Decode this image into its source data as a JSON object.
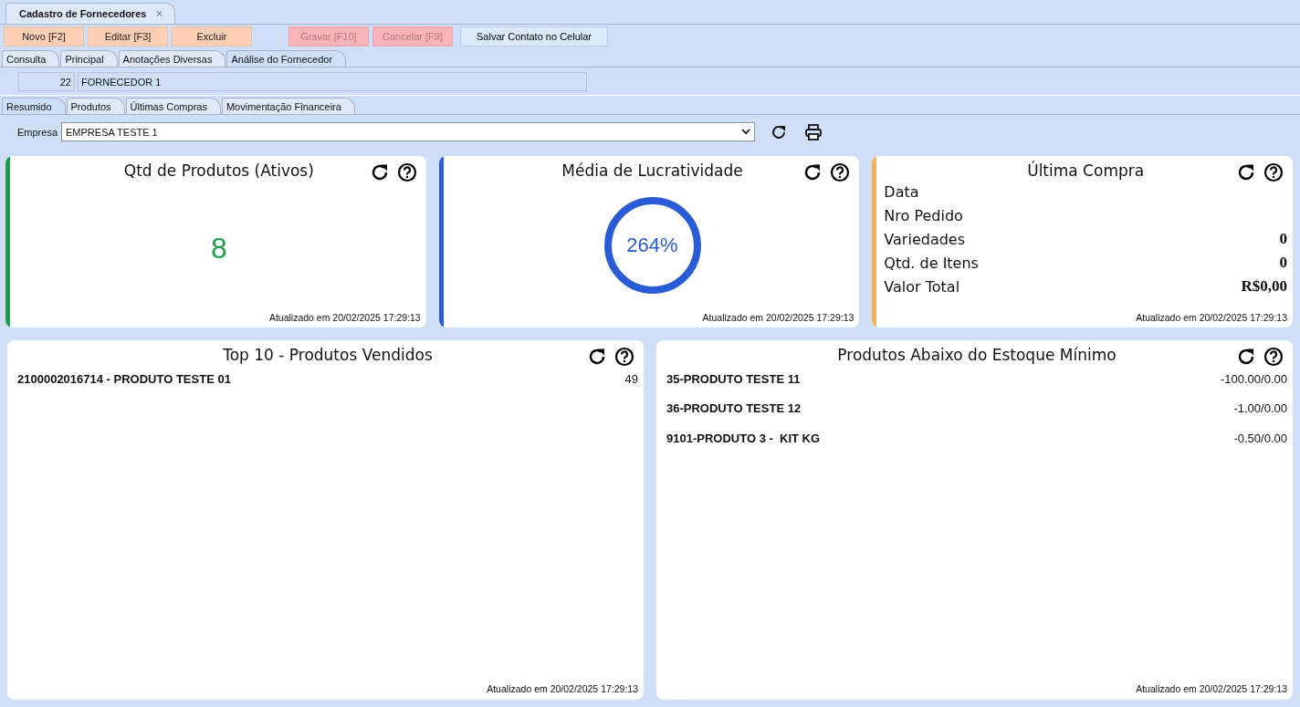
{
  "document_tab": {
    "title": "Cadastro de Fornecedores",
    "close": "×"
  },
  "toolbar": [
    [
      {
        "label": "Novo [F2]",
        "kind": "action",
        "disabled": false
      },
      {
        "label": "Editar [F3]",
        "kind": "action",
        "disabled": false
      },
      {
        "label": "Excluir",
        "kind": "action",
        "disabled": false
      }
    ],
    [
      {
        "label": "Gravar [F10]",
        "kind": "action",
        "disabled": true
      },
      {
        "label": "Cancelar [F9]",
        "kind": "action",
        "disabled": true
      }
    ],
    [
      {
        "label": "Salvar Contato no Celular",
        "kind": "info",
        "disabled": false
      }
    ]
  ],
  "main_tabs": [
    {
      "label": "Consulta",
      "selected": false
    },
    {
      "label": "Principal",
      "selected": false
    },
    {
      "label": "Anotações Diversas",
      "selected": false
    },
    {
      "label": "Análise do Fornecedor",
      "selected": true
    }
  ],
  "supplier": {
    "code": "22",
    "name": "FORNECEDOR 1"
  },
  "sub_tabs": [
    {
      "label": "Resumido",
      "selected": true
    },
    {
      "label": "Produtos",
      "selected": false
    },
    {
      "label": "Últimas Compras",
      "selected": false
    },
    {
      "label": "Movimentação Financeira",
      "selected": false
    }
  ],
  "company": {
    "label": "Empresa",
    "value": "EMPRESA TESTE 1"
  },
  "top_cards": [
    {
      "kind": "count",
      "title": "Qtd de Produtos (Ativos)",
      "color": "#1e9e4a",
      "value": "8",
      "updated": "Atualizado em 20/02/2025 17:29:13"
    },
    {
      "kind": "ring",
      "title": "Média de Lucratividade",
      "color": "#2a5bd7",
      "value": "264%",
      "updated": "Atualizado em 20/02/2025 17:29:13"
    },
    {
      "kind": "details",
      "title": "Última Compra",
      "color": "#f0b254",
      "rows": [
        {
          "label": "Data"
        },
        {
          "label": "Nro Pedido"
        },
        {
          "label": "Variedades",
          "value": "0"
        },
        {
          "label": "Qtd. de Itens",
          "value": "0"
        },
        {
          "label": "Valor Total",
          "value": "R$0,00"
        }
      ],
      "updated": "Atualizado em 20/02/2025 17:29:13"
    }
  ],
  "bottom_cards": [
    {
      "title": "Top 10 - Produtos Vendidos",
      "rows": [
        {
          "name": "2100002016714 - PRODUTO TESTE 01",
          "value": "49"
        }
      ],
      "updated": "Atualizado em 20/02/2025 17:29:13"
    },
    {
      "title": "Produtos Abaixo do Estoque Mínimo",
      "rows": [
        {
          "name": "35-PRODUTO TESTE 11",
          "value": "-100.00/0.00"
        },
        {
          "name": "36-PRODUTO TESTE 12",
          "value": "-1.00/0.00"
        },
        {
          "name": "9101-PRODUTO 3 -  KIT KG",
          "value": "-0.50/0.00"
        }
      ],
      "updated": "Atualizado em 20/02/2025 17:29:13"
    }
  ]
}
